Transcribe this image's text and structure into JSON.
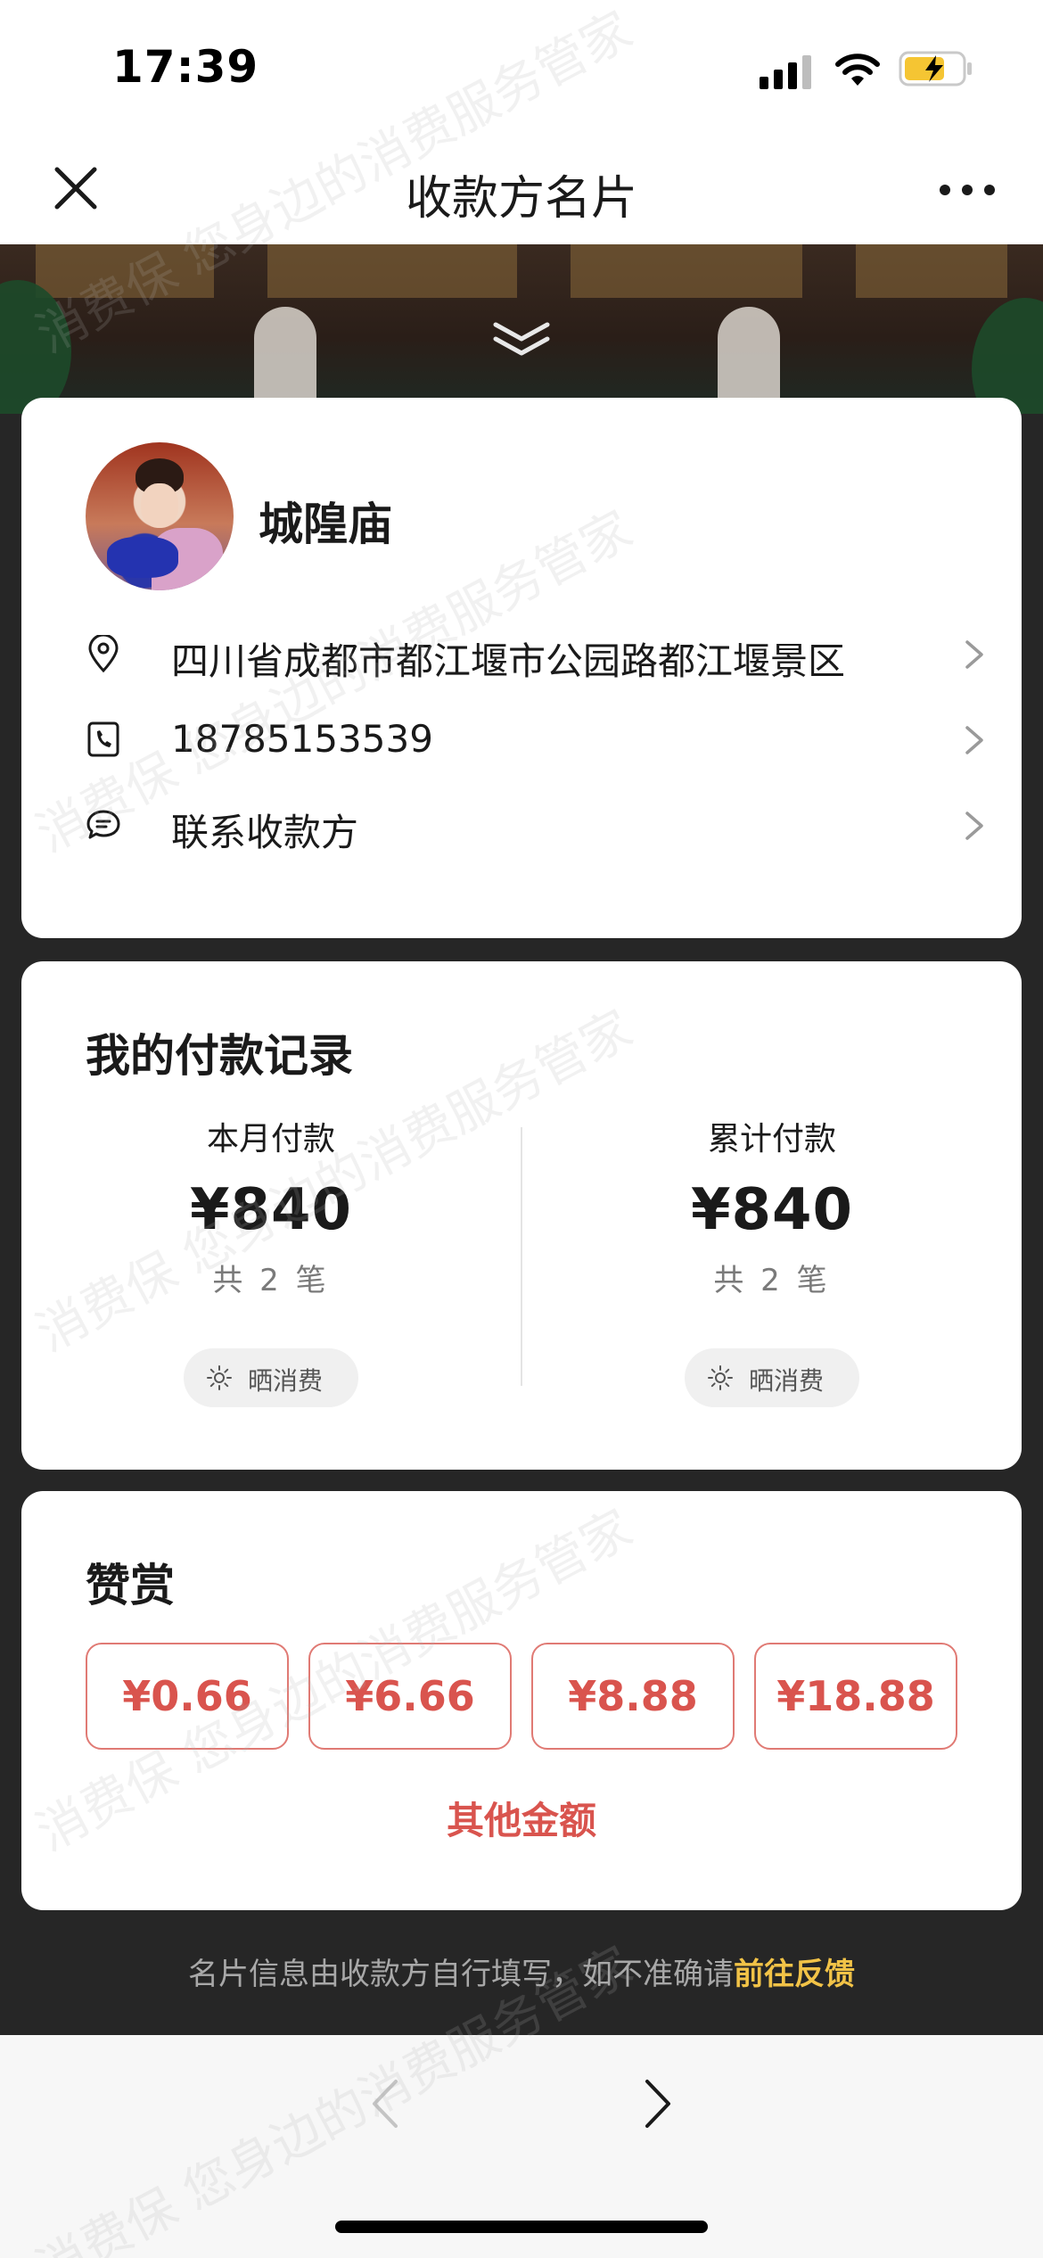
{
  "status_bar": {
    "time": "17:39"
  },
  "nav": {
    "title": "收款方名片",
    "close_icon": "close-icon",
    "more_icon": "more-icon"
  },
  "merchant": {
    "name": "城隍庙",
    "address": "四川省成都市都江堰市公园路都江堰景区",
    "phone": "18785153539",
    "contact_label": "联系收款方"
  },
  "payments": {
    "title": "我的付款记录",
    "this_month": {
      "label": "本月付款",
      "amount": "¥840",
      "count": "共 2 笔"
    },
    "total": {
      "label": "累计付款",
      "amount": "¥840",
      "count": "共 2 笔"
    },
    "share_label": "晒消费"
  },
  "tip": {
    "title": "赞赏",
    "amounts": [
      "¥0.66",
      "¥6.66",
      "¥8.88",
      "¥18.88"
    ],
    "other_label": "其他金额"
  },
  "footer": {
    "note": "名片信息由收款方自行填写，如不准确请",
    "link": "前往反馈"
  },
  "watermark_text": "消费保 您身边的消费服务管家",
  "colors": {
    "accent_red": "#d9544e",
    "link_yellow": "#f2c347",
    "battery_yellow": "#f5c533"
  }
}
